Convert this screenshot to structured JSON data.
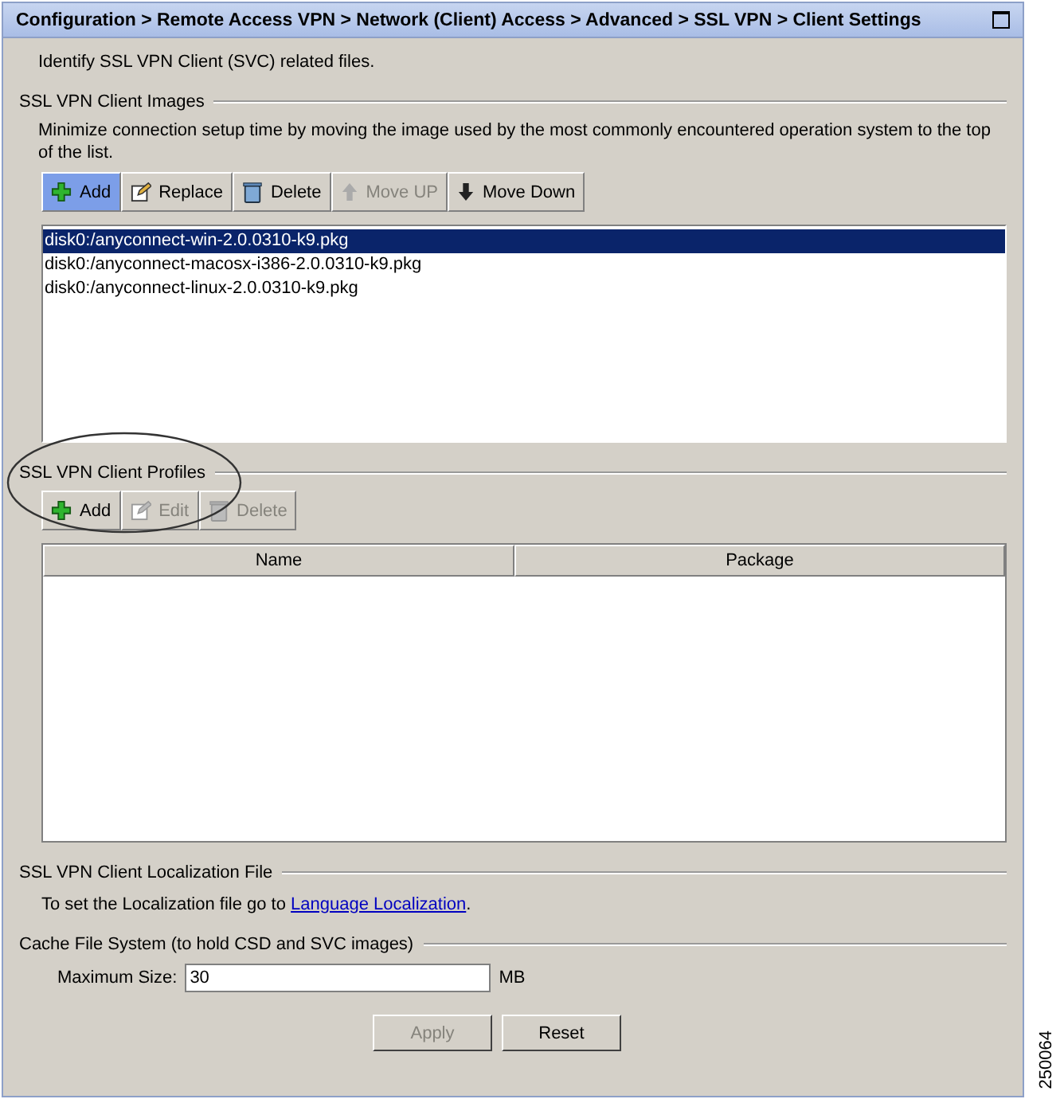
{
  "title": "Configuration > Remote Access VPN > Network (Client) Access > Advanced > SSL VPN > Client Settings",
  "intro": "Identify SSL VPN Client (SVC) related files.",
  "images": {
    "legend": "SSL VPN Client Images",
    "description": "Minimize connection setup time by moving the image used by the most commonly encountered operation system to the top of the list.",
    "buttons": [
      {
        "label": "Add",
        "kind": "plus",
        "disabled": false,
        "highlighted": true
      },
      {
        "label": "Replace",
        "kind": "edit",
        "disabled": false,
        "highlighted": false
      },
      {
        "label": "Delete",
        "kind": "trash",
        "disabled": false,
        "highlighted": false
      },
      {
        "label": "Move UP",
        "kind": "up",
        "disabled": true,
        "highlighted": false
      },
      {
        "label": "Move Down",
        "kind": "down",
        "disabled": false,
        "highlighted": false
      }
    ],
    "files": [
      {
        "name": "disk0:/anyconnect-win-2.0.0310-k9.pkg",
        "selected": true
      },
      {
        "name": "disk0:/anyconnect-macosx-i386-2.0.0310-k9.pkg",
        "selected": false
      },
      {
        "name": "disk0:/anyconnect-linux-2.0.0310-k9.pkg",
        "selected": false
      }
    ]
  },
  "profiles": {
    "legend": "SSL VPN Client Profiles",
    "buttons": [
      {
        "label": "Add",
        "kind": "plus",
        "disabled": false,
        "highlighted": false
      },
      {
        "label": "Edit",
        "kind": "edit",
        "disabled": true,
        "highlighted": false
      },
      {
        "label": "Delete",
        "kind": "trash",
        "disabled": true,
        "highlighted": false
      }
    ],
    "columns": [
      "Name",
      "Package"
    ]
  },
  "localization": {
    "legend": "SSL VPN Client Localization File",
    "text": "To set the Localization file go to",
    "link": "Language Localization",
    "suffix": "."
  },
  "cache": {
    "legend": "Cache File System (to hold CSD and SVC images)",
    "field_label": "Maximum Size:",
    "value": "30",
    "unit": "MB"
  },
  "actions": [
    {
      "label": "Apply",
      "disabled": true
    },
    {
      "label": "Reset",
      "disabled": false
    }
  ],
  "figure_id": "250064"
}
